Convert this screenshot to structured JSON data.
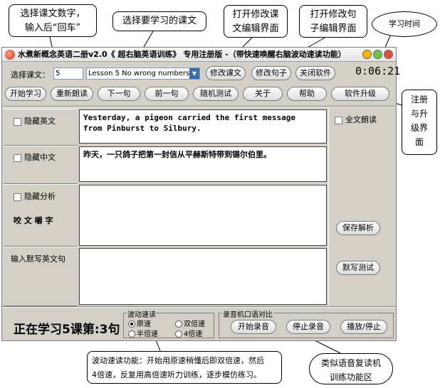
{
  "callouts": {
    "lesson_number": "选择课文数字，\n输入后“回车”",
    "lesson_select": "选择要学习的课文",
    "edit_lesson": "打开修改课\n文编辑界面",
    "edit_sentence": "打开修改句\n子编辑界面",
    "study_time": "学习时间",
    "upgrade": "注册\n与升\n级界\n面",
    "wave_speed": "波动速读功能：开始用原速稍懂后即双倍速，然后\n4倍速，反复用高倍速听力训练，逐步模仿练习。",
    "recorder": "类似语音复读机\n训练功能区"
  },
  "window": {
    "title": "水煮新概念英语二册v2.0《 超右脑英语训练》 专用注册版 -（带快速唤醒右脑波动速读功能）",
    "lesson_label": "选择课文：",
    "lesson_number_value": "5",
    "lesson_select_value": "Lesson 5  No wrong numbers",
    "timer": "0:06:21"
  },
  "toolbar_top": {
    "edit_lesson": "修改课文",
    "edit_sentence": "修改句子",
    "close_app": "关闭软件"
  },
  "toolbar": {
    "start": "开始学习",
    "reread": "重新朗读",
    "next": "下一句",
    "prev": "前一句",
    "random_test": "随机测试",
    "about": "关于",
    "help": "帮助",
    "upgrade": "软件升级"
  },
  "panels": {
    "hide_english": "隐藏英文",
    "hide_chinese": "隐藏中文",
    "hide_analysis": "隐藏分析",
    "chew_words": "咬 文 嚼 字",
    "dictation_label": "输入默写英文句",
    "full_read": "全文朗读",
    "save_analysis": "保存解析",
    "dictation_test": "默写测试",
    "english_text": "Yesterday, a pigeon carried the first message\nfrom Pinburst to Silbury.",
    "chinese_text": "昨天，一只鸽子把第一封信从平赫斯特带到锡尔伯里。"
  },
  "status": {
    "progress_text": "正在学习5课第:3句",
    "speed_group": "波动速读",
    "speed_normal": "原速",
    "speed_double": "双倍速",
    "speed_half": "半倍速",
    "speed_quad": "4倍速",
    "recorder_group": "录音机口语对比",
    "start_record": "开始录音",
    "stop_record": "停止录音",
    "play_pause": "播放/停止"
  },
  "colors": {
    "window_bg": "#d4d0c8",
    "btn_min": "#f5b400",
    "btn_max": "#6cc24a",
    "btn_close": "#e0503a"
  }
}
